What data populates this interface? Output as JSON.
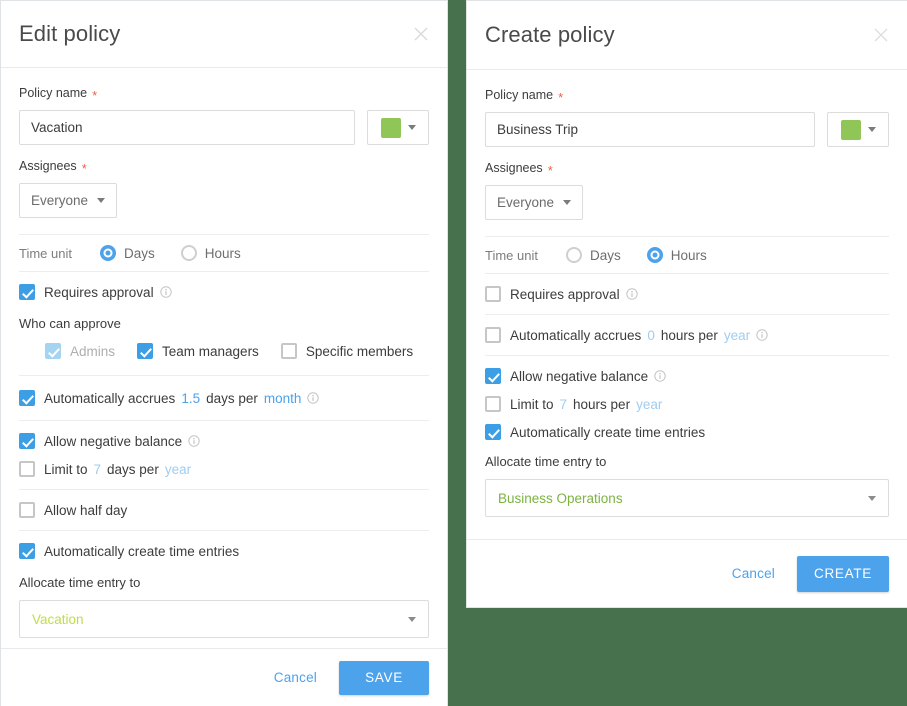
{
  "background_color": "#47704d",
  "theme": {
    "accent_blue": "#4da2ec",
    "checkbox_blue": "#3c9ee5",
    "checkbox_blue_disabled": "#a4d3f4",
    "required_star": "#e8634a",
    "swatch_green": "#90c557",
    "vacation_green": "#bfdd48",
    "business_green": "#7cb342"
  },
  "edit_dialog": {
    "title": "Edit policy",
    "close_icon": "close-icon",
    "policy_name": {
      "label": "Policy name",
      "required_marker": "*",
      "value": "Vacation",
      "placeholder": "Policy name",
      "color_swatch": "#90c557"
    },
    "assignees": {
      "label": "Assignees",
      "required_marker": "*",
      "value": "Everyone"
    },
    "time_unit": {
      "label": "Time unit",
      "options": [
        "Days",
        "Hours"
      ],
      "selected": "Days"
    },
    "requires_approval": {
      "label": "Requires approval",
      "checked": true,
      "info_icon": "info-icon"
    },
    "who_can_approve": {
      "label": "Who can approve",
      "options": [
        {
          "label": "Admins",
          "checked": true,
          "disabled": true
        },
        {
          "label": "Team managers",
          "checked": true,
          "disabled": false
        },
        {
          "label": "Specific members",
          "checked": false,
          "disabled": false
        }
      ]
    },
    "accrues": {
      "checked": true,
      "prefix": "Automatically accrues",
      "amount": "1.5",
      "middle": "days per",
      "period": "month",
      "info_icon": "info-icon"
    },
    "negative_balance": {
      "label": "Allow negative balance",
      "checked": true,
      "info_icon": "info-icon"
    },
    "limit": {
      "checked": false,
      "prefix": "Limit to",
      "amount": "7",
      "middle": "days per",
      "period": "year"
    },
    "half_day": {
      "label": "Allow half day",
      "checked": false
    },
    "auto_time_entries": {
      "label": "Automatically create time entries",
      "checked": true
    },
    "allocate": {
      "label": "Allocate time entry to",
      "value": "Vacation"
    },
    "footer": {
      "cancel_label": "Cancel",
      "submit_label": "SAVE"
    }
  },
  "create_dialog": {
    "title": "Create policy",
    "close_icon": "close-icon",
    "policy_name": {
      "label": "Policy name",
      "required_marker": "*",
      "value": "Business Trip",
      "placeholder": "Policy name",
      "color_swatch": "#90c557"
    },
    "assignees": {
      "label": "Assignees",
      "required_marker": "*",
      "value": "Everyone"
    },
    "time_unit": {
      "label": "Time unit",
      "options": [
        "Days",
        "Hours"
      ],
      "selected": "Hours"
    },
    "requires_approval": {
      "label": "Requires approval",
      "checked": false,
      "info_icon": "info-icon"
    },
    "accrues": {
      "checked": false,
      "prefix": "Automatically accrues",
      "amount": "0",
      "middle": "hours per",
      "period": "year",
      "info_icon": "info-icon"
    },
    "negative_balance": {
      "label": "Allow negative balance",
      "checked": true,
      "info_icon": "info-icon"
    },
    "limit": {
      "checked": false,
      "prefix": "Limit to",
      "amount": "7",
      "middle": "hours per",
      "period": "year"
    },
    "auto_time_entries": {
      "label": "Automatically create time entries",
      "checked": true
    },
    "allocate": {
      "label": "Allocate time entry to",
      "value": "Business Operations"
    },
    "footer": {
      "cancel_label": "Cancel",
      "submit_label": "CREATE"
    }
  }
}
